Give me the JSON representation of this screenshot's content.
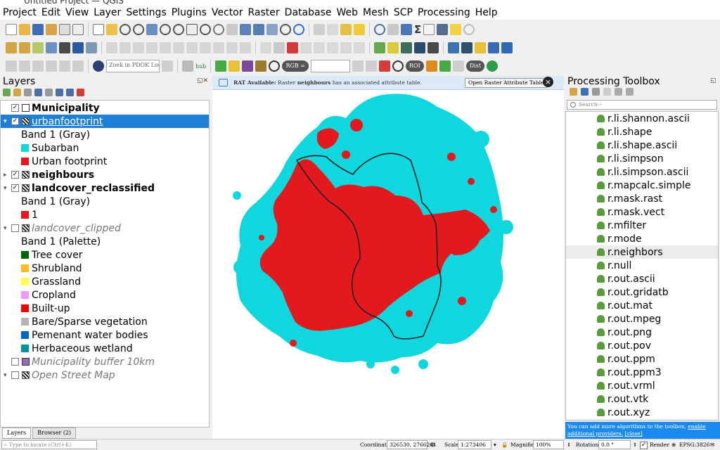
{
  "window": {
    "title": "Untitled Project — QGIS"
  },
  "menu": [
    "Project",
    "Edit",
    "View",
    "Layer",
    "Settings",
    "Plugins",
    "Vector",
    "Raster",
    "Database",
    "Web",
    "Mesh",
    "SCP",
    "Processing",
    "Help"
  ],
  "toolbar": {
    "locator_placeholder": "Zoek in PDOK Loc···",
    "hub_label": "hub",
    "rgb_label": "RGB =",
    "roi_label": "ROI",
    "dist_label": "Dist"
  },
  "layers_panel": {
    "title": "Layers",
    "tree": [
      {
        "type": "layer",
        "label": "Municipality",
        "checked": true,
        "icon": "vector",
        "style": "bold",
        "selected": false
      },
      {
        "type": "layer",
        "label": "urbanfootprint",
        "checked": true,
        "icon": "raster",
        "style": "underline",
        "selected": true,
        "expanded": true
      },
      {
        "type": "band",
        "label": "Band 1 (Gray)"
      },
      {
        "type": "legend",
        "label": "Subarban",
        "color": "#10d7dd"
      },
      {
        "type": "legend",
        "label": "Urban footprint",
        "color": "#e3191d"
      },
      {
        "type": "layer",
        "label": "neighbours",
        "checked": true,
        "icon": "raster",
        "style": "bold",
        "selected": false,
        "expanded": false
      },
      {
        "type": "layer",
        "label": "landcover_reclassified",
        "checked": true,
        "icon": "raster",
        "style": "bold",
        "selected": false,
        "expanded": true
      },
      {
        "type": "band",
        "label": "Band 1 (Gray)"
      },
      {
        "type": "legend",
        "label": "1",
        "color": "#e3191d"
      },
      {
        "type": "layer",
        "label": "landcover_clipped",
        "checked": false,
        "icon": "raster",
        "style": "italic",
        "selected": false,
        "expanded": true
      },
      {
        "type": "band",
        "label": "Band 1 (Palette)"
      },
      {
        "type": "legend",
        "label": "Tree cover",
        "color": "#006400"
      },
      {
        "type": "legend",
        "label": "Shrubland",
        "color": "#ffbb22"
      },
      {
        "type": "legend",
        "label": "Grassland",
        "color": "#ffff4c"
      },
      {
        "type": "legend",
        "label": "Cropland",
        "color": "#f096ff"
      },
      {
        "type": "legend",
        "label": "Built-up",
        "color": "#fa0000"
      },
      {
        "type": "legend",
        "label": "Bare/Sparse vegetation",
        "color": "#b4b4b4"
      },
      {
        "type": "legend",
        "label": "Pemenant water bodies",
        "color": "#0064c8"
      },
      {
        "type": "legend",
        "label": "Herbaceous wetland",
        "color": "#0096a0"
      },
      {
        "type": "layer",
        "label": "Municipality buffer 10km",
        "checked": false,
        "icon": "vector-purple",
        "style": "italic",
        "selected": false
      },
      {
        "type": "layer",
        "label": "Open Street Map",
        "checked": false,
        "icon": "raster",
        "style": "italic",
        "selected": false,
        "expanded": true
      }
    ],
    "bottom_tabs": [
      "Layers",
      "Browser (2)"
    ]
  },
  "map": {
    "rat_message_prefix": "RAT Available:",
    "rat_message_rest": "Raster",
    "rat_layer": "neighbours",
    "rat_message_suffix": "has an associated attribute table.",
    "rat_button": "Open Raster Attribute Table",
    "colors": {
      "suburban": "#10d7dd",
      "urban": "#e3191d",
      "boundary": "#222222"
    }
  },
  "processing_toolbox": {
    "title": "Processing Toolbox",
    "search_placeholder": "Search···",
    "algorithms": [
      "r.li.shannon.ascii",
      "r.li.shape",
      "r.li.shape.ascii",
      "r.li.simpson",
      "r.li.simpson.ascii",
      "r.mapcalc.simple",
      "r.mask.rast",
      "r.mask.vect",
      "r.mfilter",
      "r.mode",
      "r.neighbors",
      "r.null",
      "r.out.ascii",
      "r.out.gridatb",
      "r.out.mat",
      "r.out.mpeg",
      "r.out.png",
      "r.out.pov",
      "r.out.ppm",
      "r.out.ppm3",
      "r.out.vrml",
      "r.out.vtk",
      "r.out.xyz"
    ],
    "highlighted": "r.neighbors",
    "note_text": "You can add more algorithms to the toolbox,",
    "note_link": "enable additional providers.",
    "note_close": "[close]"
  },
  "statusbar": {
    "locator_placeholder": "Type to locate (Ctrl+K)",
    "coordinate_label": "Coordinate",
    "coordinate_value": "326530, 2766261",
    "scale_label": "Scale",
    "scale_value": "1:273406",
    "magnifier_label": "Magnifier",
    "magnifier_value": "100%",
    "rotation_label": "Rotation",
    "rotation_value": "0.0 °",
    "render_label": "Render",
    "crs_label": "EPSG:3826"
  }
}
